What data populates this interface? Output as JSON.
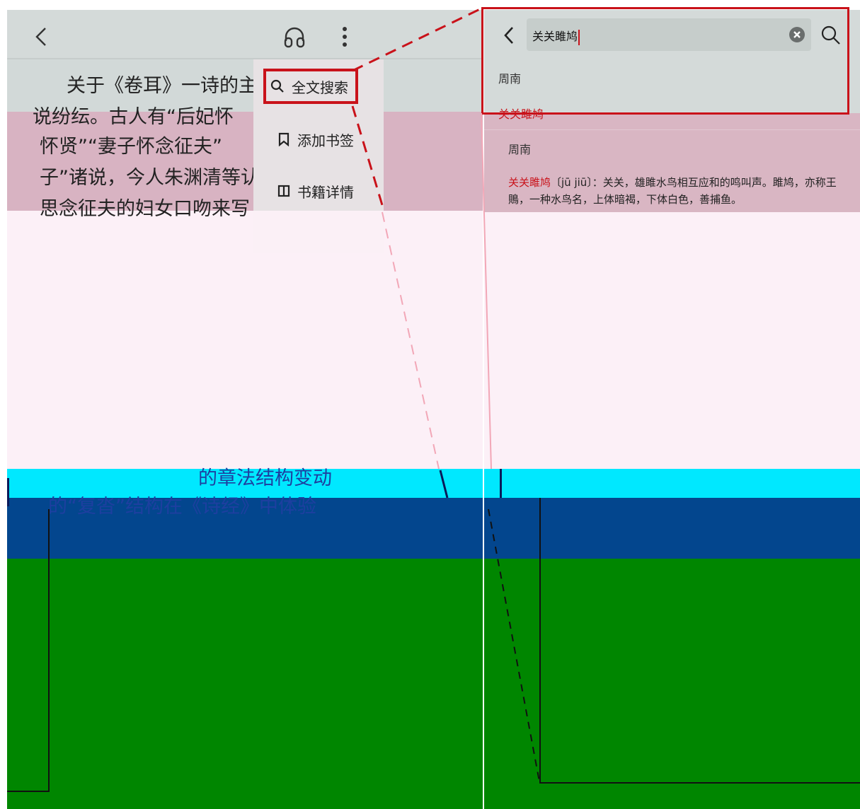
{
  "reader": {
    "lines": [
      "关于《卷耳》一诗的主",
      "说纷纭。古人有“后妃怀",
      "怀贤”“妻子怀念征夫”",
      "子”诸说，今人朱渊清等认",
      "思念征夫的妇女口吻来写"
    ],
    "blue_lines": [
      "的章法结构变动",
      "的“复沓”结构在《诗经》中体验"
    ],
    "menu": {
      "search_label": "全文搜索",
      "bookmark_label": "添加书签",
      "details_label": "书籍详情"
    }
  },
  "search": {
    "query": "关关雎鸠",
    "section_label_top": "周南",
    "highlight_preview": "关关雎鸠",
    "result": {
      "section": "周南",
      "keyword": "关关雎鸠",
      "definition": "〔jū jiū〕：关关，雄雎水鸟相互应和的鸣叫声。雎鸠，亦称王鵙，一种水鸟名，上体暗褐，下体白色，善捕鱼。"
    }
  },
  "colors": {
    "highlight_red": "#c9121a",
    "bar_grey": "#d4dad9",
    "band_pink": "#d8b3c2",
    "band_cyan": "#00e8ff",
    "band_navy": "#03468e",
    "band_green": "#008600"
  }
}
